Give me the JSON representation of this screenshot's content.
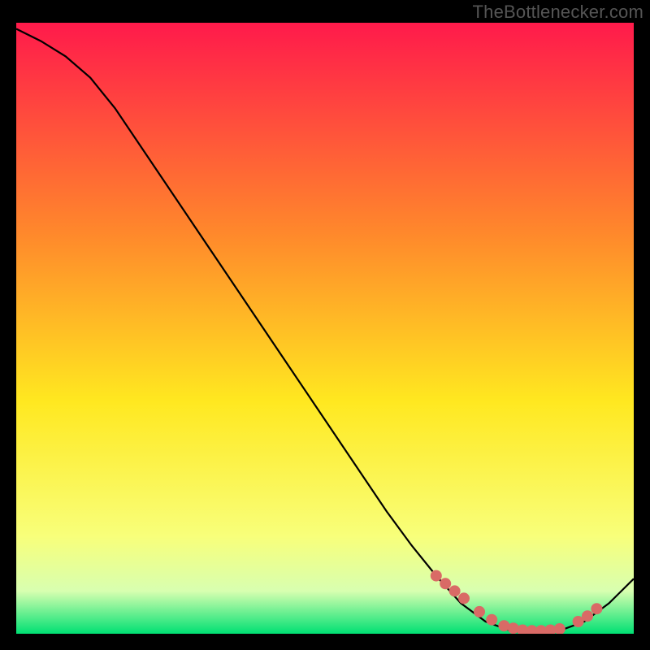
{
  "attribution": "TheBottlenecker.com",
  "colors": {
    "bg": "#000000",
    "attribution": "#555555",
    "gradient_top": "#ff1a4b",
    "gradient_mid_upper": "#ff8a2b",
    "gradient_mid": "#ffe820",
    "gradient_low": "#f8ff7a",
    "gradient_lower": "#d8ffb0",
    "gradient_bottom": "#00e073",
    "curve": "#000000",
    "marker": "#d96a66"
  },
  "chart_data": {
    "type": "line",
    "title": "",
    "xlabel": "",
    "ylabel": "",
    "xlim": [
      0,
      100
    ],
    "ylim": [
      0,
      100
    ],
    "series": [
      {
        "name": "bottleneck-curve",
        "x": [
          0,
          4,
          8,
          12,
          16,
          20,
          24,
          28,
          32,
          36,
          40,
          44,
          48,
          52,
          56,
          60,
          64,
          68,
          72,
          76,
          80,
          84,
          88,
          92,
          96,
          100
        ],
        "y": [
          99,
          97,
          94.5,
          91,
          86,
          80,
          74,
          68,
          62,
          56,
          50,
          44,
          38,
          32,
          26,
          20,
          14.5,
          9.5,
          5,
          2,
          0.5,
          0,
          0.5,
          2,
          5,
          9
        ]
      }
    ],
    "markers": {
      "name": "highlight-points",
      "x": [
        68,
        69.5,
        71,
        72.5,
        75,
        77,
        79,
        80.5,
        82,
        83.5,
        85,
        86.5,
        88,
        91,
        92.5,
        94
      ],
      "y": [
        9.5,
        8.2,
        7.0,
        5.8,
        3.6,
        2.3,
        1.3,
        0.9,
        0.6,
        0.5,
        0.5,
        0.6,
        0.8,
        2.0,
        2.9,
        4.1
      ]
    }
  }
}
